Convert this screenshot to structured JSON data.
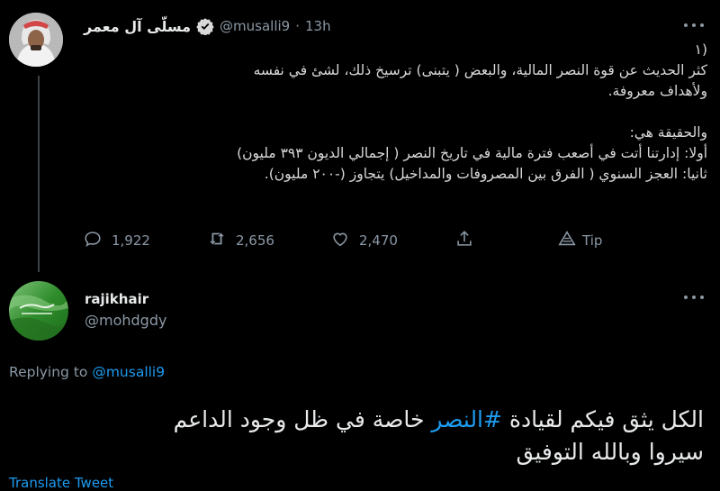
{
  "tweet1": {
    "display_name": "مسلّى آل معمر",
    "handle": "@musalli9",
    "separator": "·",
    "time": "13h",
    "lines": [
      "(١",
      "كثر الحديث عن قوة النصر المالية، والبعض ( يتبنى) ترسيخ ذلك، لشئ في نفسه",
      "ولأهداف معروفة.",
      "",
      "والحقيقة هي:",
      "أولا: إدارتنا أتت في أصعب فترة مالية في تاريخ النصر ( إجمالي الديون ٣٩٣ مليون)",
      "ثانيا: العجز السنوي ( الفرق بين المصروفات والمداخيل) يتجاوز (-٢٠٠ مليون)."
    ],
    "actions": {
      "replies": "1,922",
      "retweets": "2,656",
      "likes": "2,470",
      "tip": "Tip"
    }
  },
  "tweet2": {
    "display_name": "rajikhair",
    "handle": "@mohdgdy",
    "replying_prefix": "Replying to",
    "replying_to": "@musalli9",
    "line1_before": "الكل يثق فيكم لقيادة ",
    "hashtag": "#النصر",
    "line1_after": " خاصة في ظل وجود الداعم",
    "line2": "سيروا وبالله التوفيق",
    "translate": "Translate Tweet"
  },
  "colors": {
    "background": "#000000",
    "text": "#d9d9d9",
    "muted": "#8b98a5",
    "link": "#1d9bf0",
    "divider": "#2f3336"
  }
}
